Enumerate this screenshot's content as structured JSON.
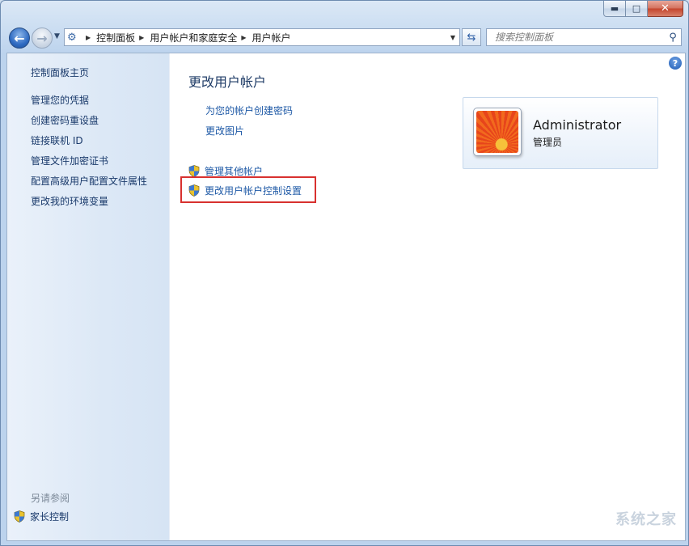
{
  "window": {
    "minimize_glyph": "▬",
    "maximize_glyph": "□",
    "close_glyph": "✕"
  },
  "navbar": {
    "back_glyph": "←",
    "forward_glyph": "→",
    "breadcrumbs": [
      "控制面板",
      "用户帐户和家庭安全",
      "用户帐户"
    ],
    "search_placeholder": "搜索控制面板"
  },
  "sidebar": {
    "home": "控制面板主页",
    "tasks": [
      "管理您的凭据",
      "创建密码重设盘",
      "链接联机 ID",
      "管理文件加密证书",
      "配置高级用户配置文件属性",
      "更改我的环境变量"
    ],
    "see_also_label": "另请参阅",
    "see_also_items": [
      "家长控制"
    ]
  },
  "main": {
    "title": "更改用户帐户",
    "links": [
      "为您的帐户创建密码",
      "更改图片"
    ],
    "shield_links": [
      "管理其他帐户",
      "更改用户帐户控制设置"
    ]
  },
  "user": {
    "name": "Administrator",
    "role": "管理员"
  },
  "watermark": "系统之家",
  "icons": {
    "help": "help-icon",
    "shield": "uac-shield-icon",
    "address": "control-panel-icon",
    "search": "search-icon"
  },
  "colors": {
    "link": "#1e59a6",
    "highlight_border": "#d8312f"
  }
}
